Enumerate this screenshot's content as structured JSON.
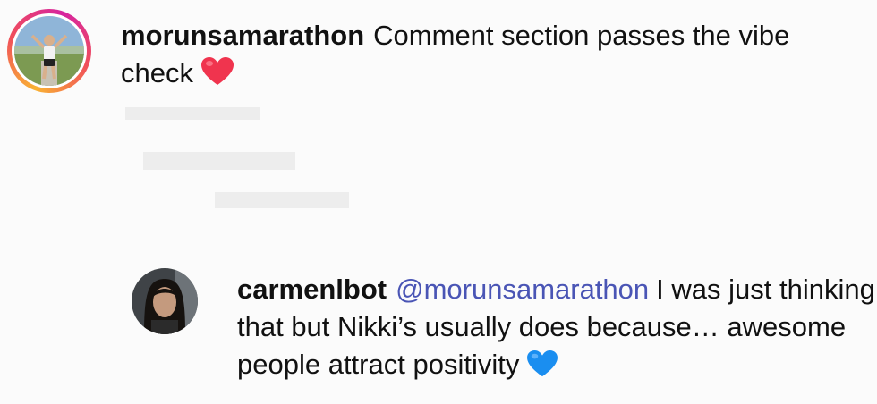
{
  "comments": [
    {
      "username": "morunsamarathon",
      "text": "Comment section passes the vibe check",
      "emoji": "red-heart",
      "emoji_color": "#f0344e",
      "has_story_ring": true
    },
    {
      "username": "carmenlbot",
      "mention": "@morunsamarathon",
      "text": "I was just thinking that but Nikki’s usually does because… awesome people attract positivity",
      "emoji": "blue-heart",
      "emoji_color": "#1a8ef0",
      "has_story_ring": false
    }
  ],
  "colors": {
    "background": "#fbfbfb",
    "text": "#111111",
    "mention": "#4a55b5"
  }
}
